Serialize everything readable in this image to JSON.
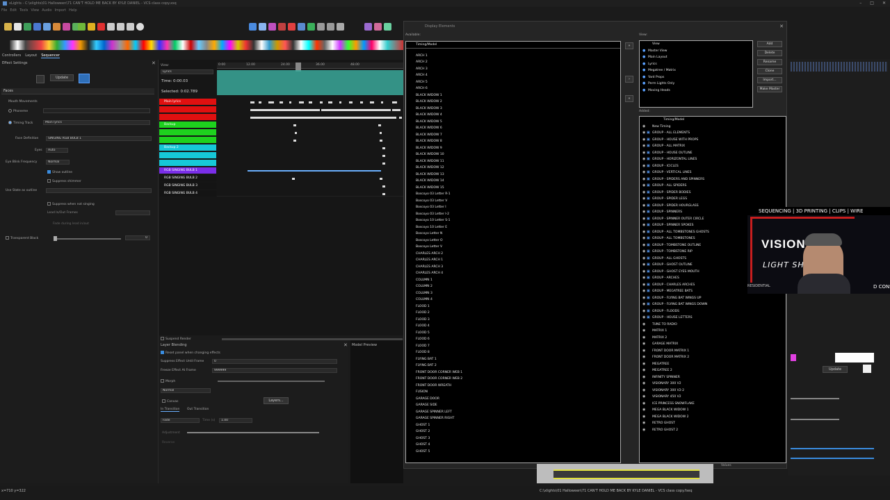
{
  "window": {
    "title": "xLights - C:\\xlights\\01 Halloween\\71 CAN'T HOLD ME BACK BY KYLE DANIEL - VCS class copy.xsq",
    "menu": [
      "File",
      "Edit",
      "Tools",
      "View",
      "Audio",
      "Import",
      "Help"
    ]
  },
  "main_tabs": [
    "Controllers",
    "Layout",
    "Sequencer"
  ],
  "effect_settings": {
    "title": "Effect Settings",
    "update": "Update",
    "effect": "Faces",
    "mouth_movements": "Mouth Movements",
    "phoneme": "Phoneme",
    "timing_track_label": "Timing Track",
    "timing_track_value": "Main lyrics",
    "face_definition_label": "Face Definition",
    "face_definition_value": "SINGING RGB BULB 1",
    "eyes_label": "Eyes",
    "eyes_value": "Auto",
    "eye_blink_label": "Eye Blink Frequency",
    "eye_blink_value": "Normal",
    "show_outline": "Show outline",
    "suppress_shimmer": "Suppress shimmer",
    "use_state_label": "Use State as outline",
    "suppress_not_singing": "Suppress when not singing",
    "lead_in_out": "Lead In/Out Frames",
    "fade_during_lead": "Fade during lead in/out",
    "transparent_black": "Transparent Black",
    "tb_value": "0"
  },
  "sequencer": {
    "view_label": "View:",
    "view_value": "Lyrics",
    "time": "Time: 0:00.03",
    "selected": "Selected: 0:02.789",
    "ruler": [
      "0:00",
      "12.00",
      "24.00",
      "36.00",
      "48.00"
    ],
    "rows": [
      {
        "label": "Main lyrics",
        "color": "#e01010"
      },
      {
        "label": "",
        "color": "#e01010"
      },
      {
        "label": "",
        "color": "#e01010"
      },
      {
        "label": "Backup",
        "color": "#1ed21e"
      },
      {
        "label": "",
        "color": "#1ed21e"
      },
      {
        "label": "",
        "color": "#1ed21e"
      },
      {
        "label": "Backup 2",
        "color": "#16c8d8"
      },
      {
        "label": "",
        "color": "#16c8d8"
      },
      {
        "label": "",
        "color": "#16c8d8"
      },
      {
        "label": "RGB SINGING BULB 1",
        "color": "#7a2ee8"
      },
      {
        "label": "RGB SINGING BULB 2",
        "color": "#141414"
      },
      {
        "label": "RGB SINGING BULB 3",
        "color": "#141414"
      },
      {
        "label": "RGB SINGING BULB 4",
        "color": "#141414"
      }
    ],
    "suspend_render": "Suspend Render"
  },
  "layer_blending": {
    "title": "Layer Blending",
    "reset_panel": "Reset panel when changing effects",
    "suppress_label": "Suppress Effect Until Frame",
    "suppress_value": "0",
    "freeze_label": "Freeze Effect At Frame",
    "freeze_value": "999999",
    "morph": "Morph",
    "normal": "Normal",
    "canvas": "Canvas",
    "layers": "Layers...",
    "in_transition": "In Transition",
    "out_transition": "Out Transition",
    "fade": "Fade",
    "time_label": "Time (s)",
    "time_value": "1.00",
    "adjustment": "Adjustment",
    "reverse": "Reverse"
  },
  "house_preview": {
    "title": "Model Preview"
  },
  "display_elements": {
    "title": "Display Elements",
    "available_label": "Available:",
    "view_label": "View:",
    "added_label": "Added:",
    "available_header": "Timing/Model",
    "available": [
      "ARCH 1",
      "ARCH 2",
      "ARCH 3",
      "ARCH 4",
      "ARCH 5",
      "ARCH 6",
      "BLACK WIDOW 1",
      "BLACK WIDOW 2",
      "BLACK WIDOW 3",
      "BLACK WIDOW 4",
      "BLACK WIDOW 5",
      "BLACK WIDOW 6",
      "BLACK WIDOW 7",
      "BLACK WIDOW 8",
      "BLACK WIDOW 9",
      "BLACK WIDOW 10",
      "BLACK WIDOW 11",
      "BLACK WIDOW 12",
      "BLACK WIDOW 13",
      "BLACK WIDOW 14",
      "BLACK WIDOW 15",
      "Boscoyo 03 Letter R-1",
      "Boscoyo 03 Letter V",
      "Boscoyo 03 Letter I",
      "Boscoyo 03 Letter I-2",
      "Boscoyo 10 Letter S-1",
      "Boscoyo 10 Letter E",
      "Boscoyo Letter N",
      "Boscoyo Letter O",
      "Boscoyo Letter V",
      "CHARLES ARCH 2",
      "CHARLES ARCH 1",
      "CHARLES ARCH 3",
      "CHARLES ARCH 4",
      "COLUMN 1",
      "COLUMN 2",
      "COLUMN 3",
      "COLUMN 4",
      "FLOOD 1",
      "FLOOD 2",
      "FLOOD 3",
      "FLOOD 4",
      "FLOOD 5",
      "FLOOD 6",
      "FLOOD 7",
      "FLOOD 8",
      "FLYING BAT 1",
      "FLYING BAT 2",
      "FRONT DOOR CORNER WEB 1",
      "FRONT DOOR CORNER WEB 2",
      "FRONT DOOR WREATH",
      "FUSION",
      "GARAGE DOOR",
      "GARAGE SIDE",
      "GARAGE SPINNER LEFT",
      "GARAGE SPINNER RIGHT",
      "GHOST 1",
      "GHOST 2",
      "GHOST 3",
      "GHOST 4",
      "GHOST 5"
    ],
    "views": [
      "Master View",
      "Main Layout",
      "Lyrics",
      "Megatree / Matrix",
      "Yard Props",
      "Perm Lights Only",
      "Moving Heads"
    ],
    "view_header": "View",
    "view_buttons": [
      "Add",
      "Delete",
      "Rename",
      "Clone",
      "Import...",
      "Make Master"
    ],
    "added_header": "Timing/Model",
    "added": [
      "New Timing",
      "GROUP - ALL ELEMENTS",
      "GROUP - HOUSE WITH PROPS",
      "GROUP - ALL MATRIX",
      "GROUP - HOUSE OUTLINE",
      "GROUP - HORIZONTAL LINES",
      "GROUP - ICICLES",
      "GROUP - VERTICAL LINES",
      "GROUP - SPIDERS AND SPINNERS",
      "GROUP - ALL SPIDERS",
      "GROUP - SPIDER BODIES",
      "GROUP - SPIDER LEGS",
      "GROUP - SPIDER HOURGLASS",
      "GROUP - SPINNERS",
      "GROUP - SPINNER OUTER CIRCLE",
      "GROUP - SPINNER SPOKES",
      "GROUP - ALL TOMBSTONES GHOSTS",
      "GROUP - ALL TOMBSTONES",
      "GROUP - TOMBSTONE OUTLINE",
      "GROUP - TOMBSTONE RIP",
      "GROUP - ALL GHOSTS",
      "GROUP - GHOST OUTLINE",
      "GROUP - GHOST EYES MOUTH",
      "GROUP - ARCHES",
      "GROUP - CHARLES ARCHES",
      "GROUP - MEGATREE BATS",
      "GROUP - FLYING BAT WINGS UP",
      "GROUP - FLYING BAT WINGS DOWN",
      "GROUP - FLOODS",
      "GROUP - HOUSE LETTERS",
      "TUNE TO RADIO",
      "MATRIX 1",
      "MATRIX 2",
      "GARAGE MATRIX",
      "FRONT DOOR MATRIX 1",
      "FRONT DOOR MATRIX 2",
      "MEGATREE",
      "MEGATREE 2",
      "INFINITY SPINNER",
      "VISIONARY 300 V2",
      "VISIONARY 300 V2-2",
      "VISIONARY 450 V2",
      "ICE PRINCESS SNOWFLAKE",
      "MEGA BLACK WIDOW 1",
      "MEGA BLACK WIDOW 2",
      "RETRO GHOST",
      "RETRO GHOST 2"
    ]
  },
  "overlay": {
    "banner": "SEQUENCING | 3D PRINTING | CLIPS | WIRE",
    "logo_line1": "VISIONARY",
    "logo_line2": "LIGHT SHOWS",
    "side_text": "D CONSULTI",
    "tag": "RESIDENTIAL"
  },
  "right_panel": {
    "update": "Update",
    "values": "Values"
  },
  "status": {
    "coords": "x=710 y=322",
    "file": "C:\\xlights\\01 Halloween\\71 CAN'T HOLD ME BACK BY KYLE DANIEL - VCS class copy.fseq"
  },
  "colors": {
    "accent": "#3a8de0",
    "red": "#e01010",
    "green": "#1ed21e",
    "cyan": "#16c8d8",
    "purple": "#7a2ee8",
    "waveform": "#3aa89a"
  }
}
